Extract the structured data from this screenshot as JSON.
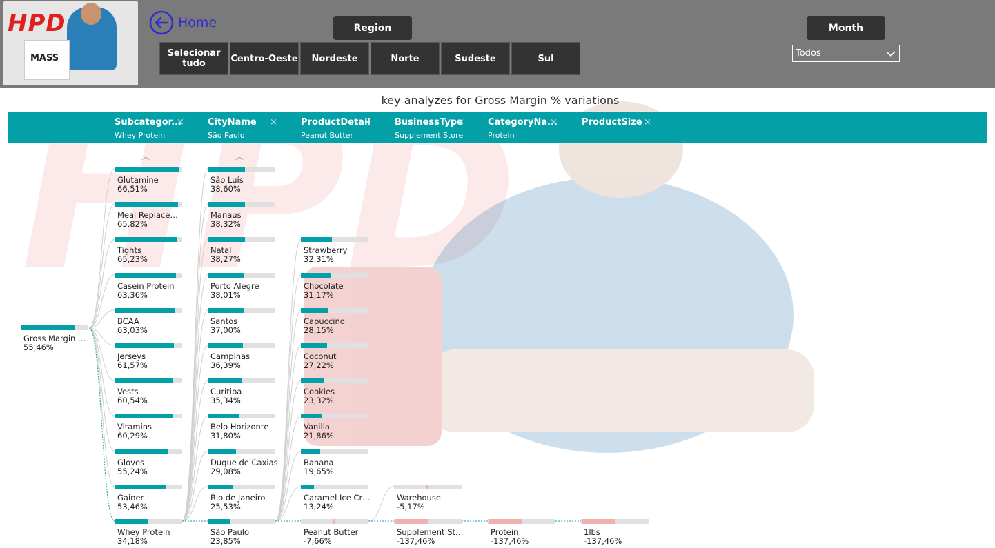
{
  "header": {
    "logo_text": "HPD",
    "logo_tub_text": "MASS",
    "home_label": "Home",
    "region_title": "Region",
    "month_title": "Month",
    "month_value": "Todos",
    "region_buttons": [
      "Selecionar tudo",
      "Centro-Oeste",
      "Nordeste",
      "Norte",
      "Sudeste",
      "Sul"
    ]
  },
  "panel": {
    "title": "key analyzes for Gross Margin % variations",
    "levels": [
      {
        "field": "Subcategor...",
        "value": "Whey Protein"
      },
      {
        "field": "CityName",
        "value": "São Paulo"
      },
      {
        "field": "ProductDetail",
        "value": "Peanut Butter"
      },
      {
        "field": "BusinessType",
        "value": "Supplement Store"
      },
      {
        "field": "CategoryNa...",
        "value": "Protein"
      },
      {
        "field": "ProductSize",
        "value": ""
      }
    ],
    "close_glyph": "×",
    "root": {
      "label": "Gross Margin %...",
      "value": "55,46%",
      "pct": 55.46
    }
  },
  "tree": {
    "subcategory": [
      {
        "label": "Glutamine",
        "value": "66,51%",
        "pct": 66.51
      },
      {
        "label": "Meal Replacem...",
        "value": "65,82%",
        "pct": 65.82
      },
      {
        "label": "Tights",
        "value": "65,23%",
        "pct": 65.23
      },
      {
        "label": "Casein Protein",
        "value": "63,36%",
        "pct": 63.36
      },
      {
        "label": "BCAA",
        "value": "63,03%",
        "pct": 63.03
      },
      {
        "label": "Jerseys",
        "value": "61,57%",
        "pct": 61.57
      },
      {
        "label": "Vests",
        "value": "60,54%",
        "pct": 60.54
      },
      {
        "label": "Vitamins",
        "value": "60,29%",
        "pct": 60.29
      },
      {
        "label": "Gloves",
        "value": "55,24%",
        "pct": 55.24
      },
      {
        "label": "Gainer",
        "value": "53,46%",
        "pct": 53.46
      },
      {
        "label": "Whey Protein",
        "value": "34,18%",
        "pct": 34.18
      }
    ],
    "city": [
      {
        "label": "São Luís",
        "value": "38,60%",
        "pct": 38.6
      },
      {
        "label": "Manaus",
        "value": "38,32%",
        "pct": 38.32
      },
      {
        "label": "Natal",
        "value": "38,27%",
        "pct": 38.27
      },
      {
        "label": "Porto Alegre",
        "value": "38,01%",
        "pct": 38.01
      },
      {
        "label": "Santos",
        "value": "37,00%",
        "pct": 37.0
      },
      {
        "label": "Campinas",
        "value": "36,39%",
        "pct": 36.39
      },
      {
        "label": "Curitiba",
        "value": "35,34%",
        "pct": 35.34
      },
      {
        "label": "Belo Horizonte",
        "value": "31,80%",
        "pct": 31.8
      },
      {
        "label": "Duque de Caxias",
        "value": "29,08%",
        "pct": 29.08
      },
      {
        "label": "Rio de Janeiro",
        "value": "25,53%",
        "pct": 25.53
      },
      {
        "label": "São Paulo",
        "value": "23,85%",
        "pct": 23.85
      }
    ],
    "product_detail": [
      {
        "label": "Strawberry",
        "value": "32,31%",
        "pct": 32.31
      },
      {
        "label": "Chocolate",
        "value": "31,17%",
        "pct": 31.17
      },
      {
        "label": "Capuccino",
        "value": "28,15%",
        "pct": 28.15
      },
      {
        "label": "Coconut",
        "value": "27,22%",
        "pct": 27.22
      },
      {
        "label": "Cookies",
        "value": "23,32%",
        "pct": 23.32
      },
      {
        "label": "Vanilla",
        "value": "21,86%",
        "pct": 21.86
      },
      {
        "label": "Banana",
        "value": "19,65%",
        "pct": 19.65
      },
      {
        "label": "Caramel Ice Cre...",
        "value": "13,24%",
        "pct": 13.24
      },
      {
        "label": "Peanut Butter",
        "value": "-7,66%",
        "pct": -7.66
      }
    ],
    "business_type": [
      {
        "label": "Warehouse",
        "value": "-5,17%",
        "pct": -5.17
      },
      {
        "label": "Supplement Store",
        "value": "-137,46%",
        "pct": -137.46
      }
    ],
    "category": [
      {
        "label": "Protein",
        "value": "-137,46%",
        "pct": -137.46
      }
    ],
    "product_size": [
      {
        "label": "1lbs",
        "value": "-137,46%",
        "pct": -137.46
      }
    ]
  },
  "colors": {
    "accent": "#04a0a8",
    "header_bg": "#7a7a7a",
    "button_bg": "#333333",
    "negative": "#f0b0b0"
  }
}
